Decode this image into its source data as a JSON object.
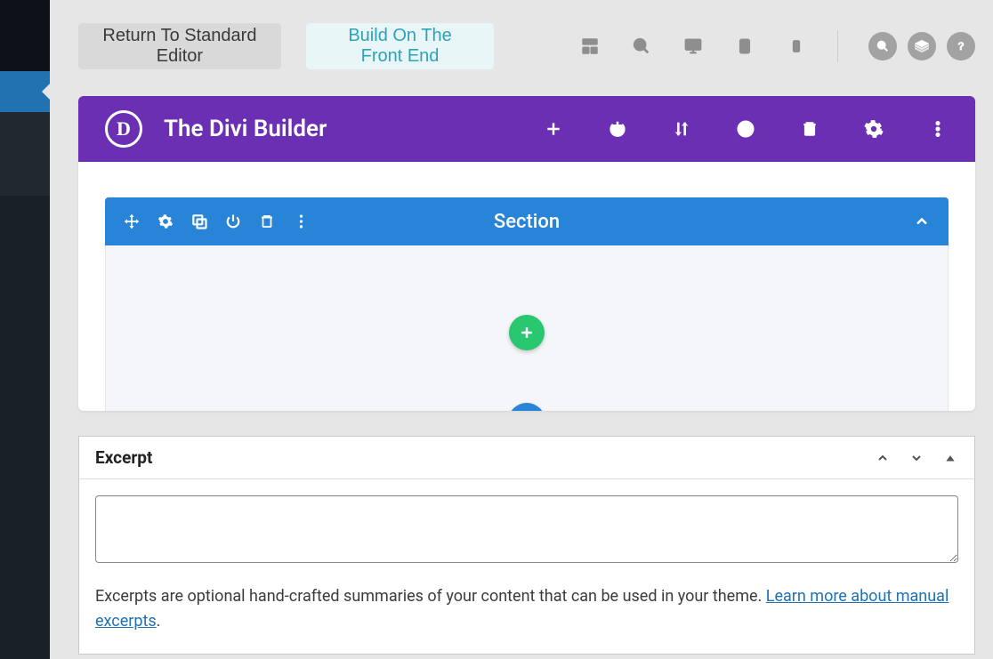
{
  "toolbar": {
    "return_label": "Return To Standard Editor",
    "build_label": "Build On The Front End"
  },
  "builder": {
    "logo_letter": "D",
    "title": "The Divi Builder",
    "section_label": "Section"
  },
  "meta": {
    "excerpt_title": "Excerpt",
    "desc_before": "Excerpts are optional hand-crafted summaries of your content that can be used in your theme. ",
    "desc_link": "Learn more about manual excerpts",
    "desc_after": "."
  }
}
